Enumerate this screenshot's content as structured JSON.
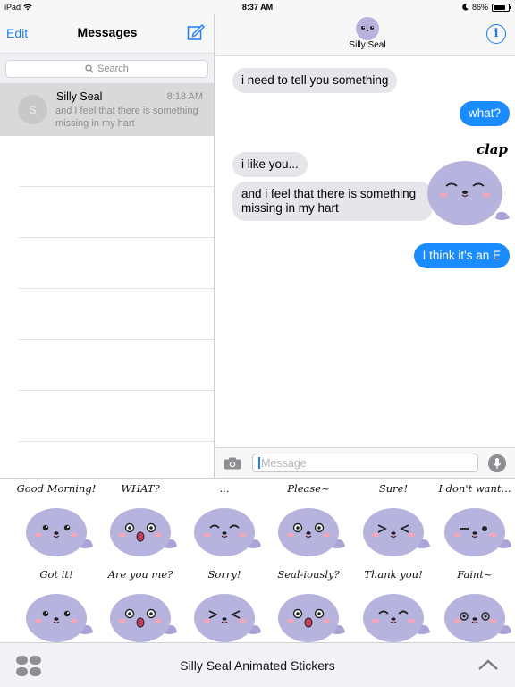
{
  "status_bar": {
    "device": "iPad",
    "time": "8:37 AM",
    "battery": "86%"
  },
  "conversations_pane": {
    "edit_label": "Edit",
    "title": "Messages",
    "search_placeholder": "Search",
    "conversations": [
      {
        "name": "Silly Seal",
        "time": "8:18 AM",
        "avatar_initial": "S",
        "preview": "and I feel that there is something missing in my hart"
      }
    ]
  },
  "chat": {
    "contact_name": "Silly Seal",
    "info_label": "i",
    "messages": [
      {
        "direction": "incoming",
        "text": "i need to tell you something"
      },
      {
        "direction": "outgoing",
        "text": "what?"
      },
      {
        "direction": "incoming",
        "text": "i like you..."
      },
      {
        "direction": "incoming",
        "text": "and i feel that there is something missing in my hart"
      },
      {
        "direction": "outgoing",
        "text": "I think it's an E"
      }
    ],
    "inline_sticker_caption": "clap",
    "composer_placeholder": "Message"
  },
  "sticker_drawer": {
    "title": "Silly Seal Animated Stickers",
    "stickers": [
      {
        "caption": "Good Morning!"
      },
      {
        "caption": "WHAT?"
      },
      {
        "caption": "..."
      },
      {
        "caption": "Please~"
      },
      {
        "caption": "Sure!"
      },
      {
        "caption": "I don't want..."
      },
      {
        "caption": "Got it!"
      },
      {
        "caption": "Are you me?"
      },
      {
        "caption": "Sorry!"
      },
      {
        "caption": "Seal-iously?"
      },
      {
        "caption": "Thank you!"
      },
      {
        "caption": "Faint~"
      }
    ]
  },
  "colors": {
    "accent": "#1a7ef7",
    "outgoing_bubble": "#1a8cff",
    "incoming_bubble": "#e5e5ea",
    "seal": "#b7b3df"
  }
}
